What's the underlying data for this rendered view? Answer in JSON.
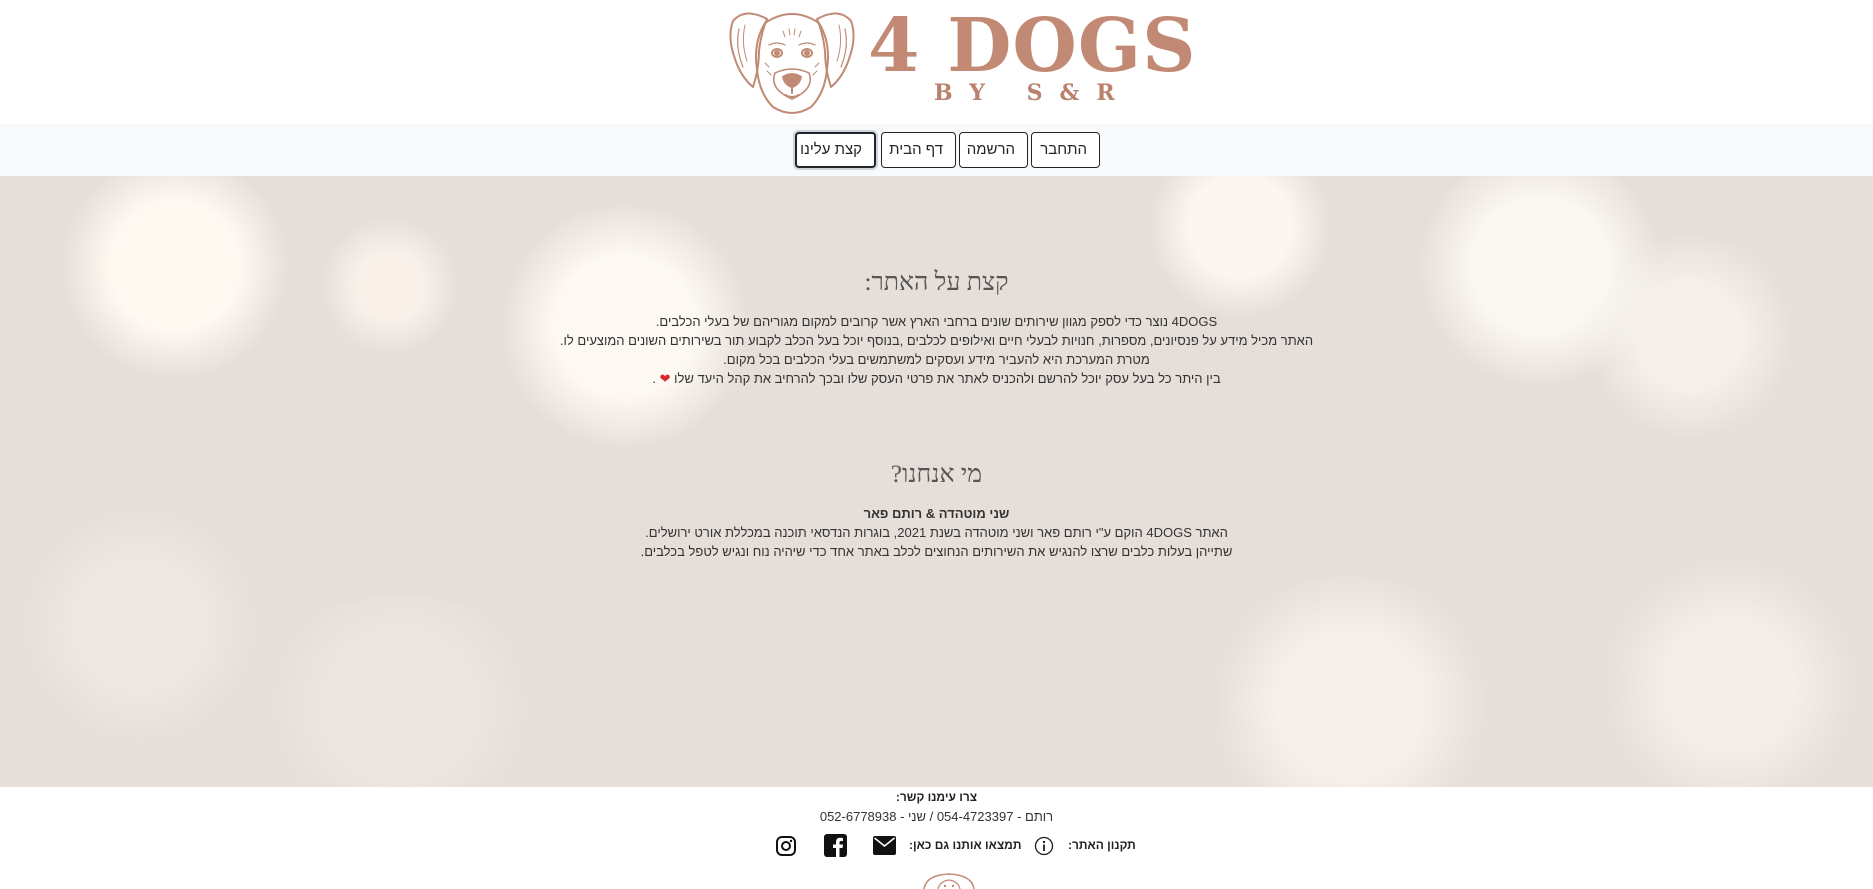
{
  "logo": {
    "main_text": "4 DOGS",
    "sub_text": "BY S&R"
  },
  "nav": {
    "items": [
      {
        "label": "התחבר"
      },
      {
        "label": "הרשמה"
      },
      {
        "label": "דף הבית"
      },
      {
        "label": "קצת עלינו",
        "active": true
      }
    ]
  },
  "about": {
    "title": "קצת על האתר:",
    "lines": [
      "4DOGS נוצר כדי לספק מגוון שירותים שונים ברחבי הארץ אשר קרובים למקום מגוריהם של בעלי הכלבים.",
      "האתר מכיל מידע על פנסיונים, מספרות, חנויות לבעלי חיים ואילופים לכלבים ,בנוסף יוכל בעל הכלב לקבוע תור בשירותים השונים המוצעים לו.",
      "מטרת המערכת היא להעביר מידע ועסקים למשתמשים בעלי הכלבים בכל מקום.",
      "בין היתר כל בעל עסק יוכל להרשם ולהכניס לאתר את פרטי העסק שלו ובכך להרחיב את קהל היעד שלו"
    ],
    "heart": "❤",
    "line4_end": "."
  },
  "who": {
    "title": "מי אנחנו?",
    "names": "שני מוטהדה & רותם פאר",
    "lines": [
      "האתר 4DOGS הוקם ע\"י רותם פאר ושני מוטהדה בשנת 2021, בוגרות הנדסאי תוכנה במכללת אורט ירושלים.",
      "שתייהן בעלות כלבים שרצו להנגיש את השירותים הנחוצים לכלב באתר אחד כדי שיהיה נוח ונגיש לטפל בכלבים."
    ]
  },
  "footer": {
    "contact_title": "צרו עימנו קשר:",
    "phones": "רותם - 054-4723397 / שני - 052-6778938",
    "terms_label": "תקנון האתר:",
    "find_us_label": "תמצאו אותנו גם כאן:",
    "icons": [
      "info-icon",
      "mail-icon",
      "facebook-icon",
      "instagram-icon"
    ]
  },
  "colors": {
    "logo_copper": "#c28a74",
    "hero_bg": "#e6ded9",
    "nav_bg": "#f8f9fa"
  }
}
